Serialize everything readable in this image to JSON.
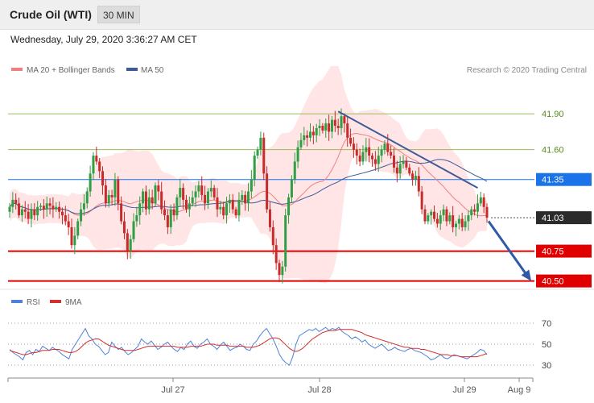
{
  "header": {
    "title": "Crude Oil (WTI)",
    "interval": "30 MIN"
  },
  "date_line": "Wednesday, July 29, 2020 3:36:27 AM CET",
  "credit": "Research © 2020 Trading Central",
  "colors": {
    "price_up": "#2f9e44",
    "price_down": "#c92a2a",
    "band": "#ffdcdc",
    "ma20": "#f08080",
    "ma50": "#3d5a99",
    "rsi": "#4f81d8",
    "rsi_ma": "#d32f2f",
    "resistance": "#9bbb59",
    "pivot": "#1a73e8",
    "support": "#e00000",
    "last": "#2b2b2b"
  },
  "chart_data": [
    {
      "type": "candlestick",
      "legend": [
        {
          "name": "MA 20 + Bollinger Bands",
          "color": "#f08080"
        },
        {
          "name": "MA 50",
          "color": "#3d5a99"
        }
      ],
      "legend_position": "top-left",
      "y_range": [
        40.45,
        42.3
      ],
      "x_ticks": [
        "Jul 27",
        "Jul 28",
        "Jul 29",
        "Aug 9"
      ],
      "levels": [
        {
          "label": "41.90",
          "value": 41.9,
          "kind": "resistance"
        },
        {
          "label": "41.60",
          "value": 41.6,
          "kind": "resistance"
        },
        {
          "label": "41.35",
          "value": 41.35,
          "kind": "pivot"
        },
        {
          "label": "41.03",
          "value": 41.03,
          "kind": "last"
        },
        {
          "label": "40.75",
          "value": 40.75,
          "kind": "support"
        },
        {
          "label": "40.50",
          "value": 40.5,
          "kind": "support"
        }
      ],
      "trendline": {
        "start": 41.92,
        "end": 41.28
      },
      "forecast_arrow": {
        "from": 41.0,
        "to": 40.5
      },
      "closes": [
        41.12,
        41.18,
        41.15,
        41.05,
        41.1,
        41.08,
        41.02,
        41.1,
        41.05,
        41.12,
        41.13,
        41.1,
        41.15,
        41.13,
        41.1,
        41.12,
        41.08,
        41.05,
        41.0,
        40.95,
        40.8,
        40.88,
        41.0,
        41.1,
        41.15,
        41.25,
        41.4,
        41.55,
        41.5,
        41.42,
        41.3,
        41.15,
        41.22,
        41.2,
        41.35,
        41.15,
        41.0,
        40.9,
        40.75,
        40.85,
        41.0,
        41.05,
        41.15,
        41.25,
        41.1,
        41.2,
        41.15,
        41.3,
        41.25,
        41.1,
        41.05,
        40.95,
        41.1,
        41.05,
        41.2,
        41.28,
        41.18,
        41.1,
        41.15,
        41.2,
        41.25,
        41.3,
        41.22,
        41.15,
        41.25,
        41.28,
        41.2,
        41.1,
        41.12,
        41.05,
        41.15,
        41.18,
        41.1,
        41.05,
        41.18,
        41.22,
        41.15,
        41.25,
        41.35,
        41.55,
        41.6,
        41.7,
        41.4,
        41.1,
        40.95,
        40.8,
        40.65,
        40.55,
        40.62,
        41.05,
        41.2,
        41.35,
        41.5,
        41.62,
        41.68,
        41.72,
        41.7,
        41.75,
        41.72,
        41.78,
        41.8,
        41.76,
        41.82,
        41.75,
        41.85,
        41.8,
        41.78,
        41.88,
        41.82,
        41.7,
        41.65,
        41.6,
        41.55,
        41.5,
        41.58,
        41.62,
        41.55,
        41.52,
        41.48,
        41.55,
        41.6,
        41.65,
        41.58,
        41.55,
        41.45,
        41.4,
        41.48,
        41.5,
        41.45,
        41.4,
        41.35,
        41.38,
        41.25,
        41.1,
        41.0,
        41.05,
        41.08,
        41.02,
        40.98,
        41.05,
        41.1,
        41.0,
        41.05,
        40.95,
        40.98,
        41.02,
        40.95,
        41.0,
        41.05,
        41.1,
        41.08,
        41.15,
        41.2,
        41.12,
        41.03
      ],
      "rsi_window": {
        "label": "RSI",
        "ma_label": "9MA",
        "y_ticks": [
          "70",
          "50",
          "30"
        ]
      },
      "rsi": [
        45,
        42,
        40,
        38,
        35,
        42,
        44,
        40,
        45,
        43,
        48,
        46,
        44,
        47,
        45,
        43,
        40,
        38,
        36,
        45,
        50,
        55,
        60,
        65,
        58,
        55,
        50,
        48,
        44,
        40,
        42,
        52,
        48,
        45,
        47,
        43,
        40,
        42,
        45,
        48,
        55,
        52,
        50,
        53,
        49,
        45,
        47,
        50,
        52,
        48,
        45,
        43,
        47,
        45,
        50,
        53,
        48,
        46,
        50,
        52,
        55,
        50,
        48,
        45,
        49,
        52,
        48,
        44,
        46,
        47,
        50,
        48,
        45,
        44,
        50,
        53,
        58,
        62,
        65,
        60,
        55,
        48,
        40,
        35,
        32,
        30,
        38,
        50,
        58,
        60,
        62,
        64,
        63,
        65,
        62,
        64,
        66,
        63,
        65,
        64,
        66,
        62,
        60,
        58,
        55,
        57,
        55,
        52,
        54,
        50,
        48,
        46,
        48,
        50,
        47,
        44,
        45,
        47,
        45,
        44,
        43,
        45,
        46,
        44,
        43,
        42,
        40,
        38,
        35,
        36,
        38,
        40,
        37,
        36,
        38,
        40,
        39,
        38,
        37,
        36,
        38,
        40,
        42,
        45,
        44,
        40
      ],
      "rsi_ma": [
        44,
        43,
        42,
        41,
        40,
        40,
        41,
        42,
        42,
        43,
        44,
        44,
        44,
        45,
        45,
        45,
        44,
        43,
        42,
        42,
        43,
        45,
        48,
        51,
        53,
        54,
        55,
        55,
        53,
        51,
        49,
        48,
        47,
        46,
        45,
        44,
        44,
        44,
        44,
        45,
        46,
        47,
        48,
        48,
        48,
        48,
        48,
        48,
        48,
        48,
        48,
        47,
        47,
        47,
        47,
        48,
        48,
        48,
        48,
        49,
        50,
        50,
        50,
        49,
        49,
        49,
        49,
        48,
        48,
        48,
        48,
        48,
        47,
        47,
        47,
        48,
        49,
        51,
        53,
        55,
        56,
        56,
        55,
        52,
        49,
        46,
        44,
        43,
        44,
        46,
        49,
        52,
        55,
        57,
        59,
        61,
        62,
        63,
        63,
        63,
        64,
        64,
        64,
        64,
        64,
        63,
        62,
        61,
        59,
        58,
        57,
        56,
        55,
        54,
        53,
        52,
        51,
        50,
        49,
        48,
        47,
        47,
        46,
        46,
        46,
        45,
        45,
        44,
        43,
        42,
        41,
        40,
        40,
        40,
        39,
        39,
        39,
        38,
        38,
        38,
        38,
        38,
        38,
        39,
        40,
        41
      ]
    }
  ]
}
